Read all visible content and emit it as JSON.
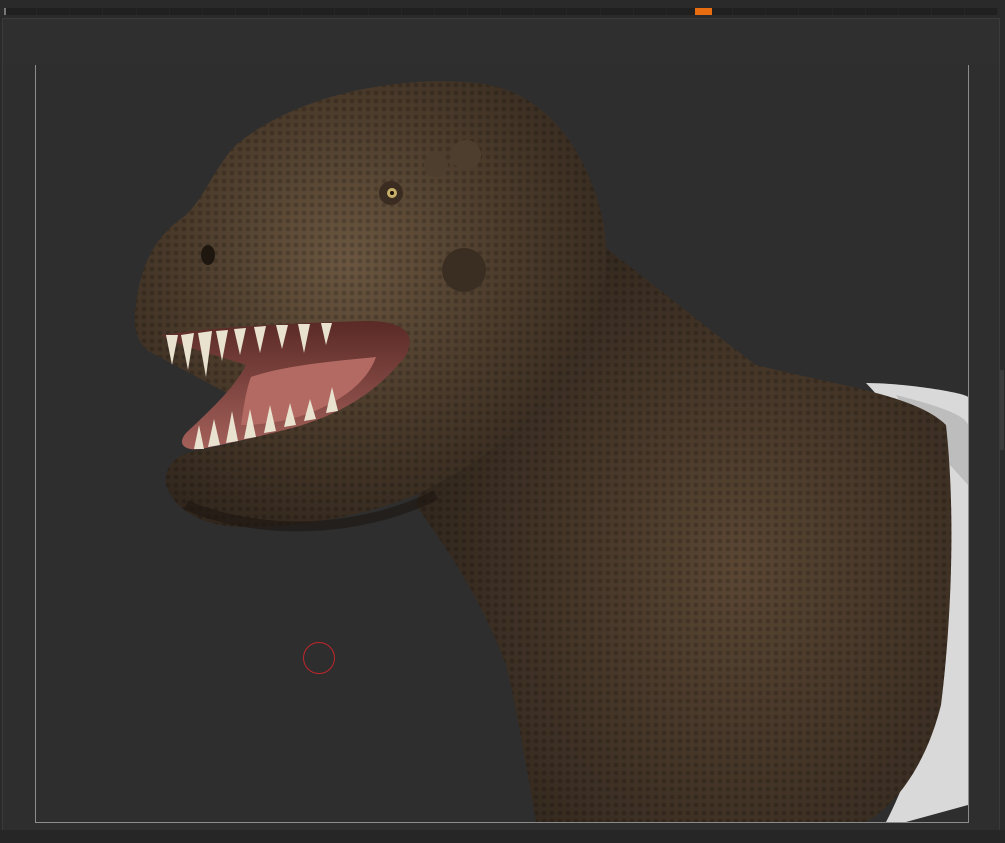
{
  "app": {
    "accent_color": "#e86d10",
    "background_color": "#2e2e2e",
    "frame_color": "#8c8c8c",
    "brush_cursor_color": "#c0262b",
    "viewport_subject": "tyrannosaurus-rex-sculpt"
  },
  "timeline": {
    "segments": 30,
    "marker_icon": "timeline-keyframe-marker"
  },
  "canvas": {
    "cursor_icon": "brush-circle-cursor"
  }
}
